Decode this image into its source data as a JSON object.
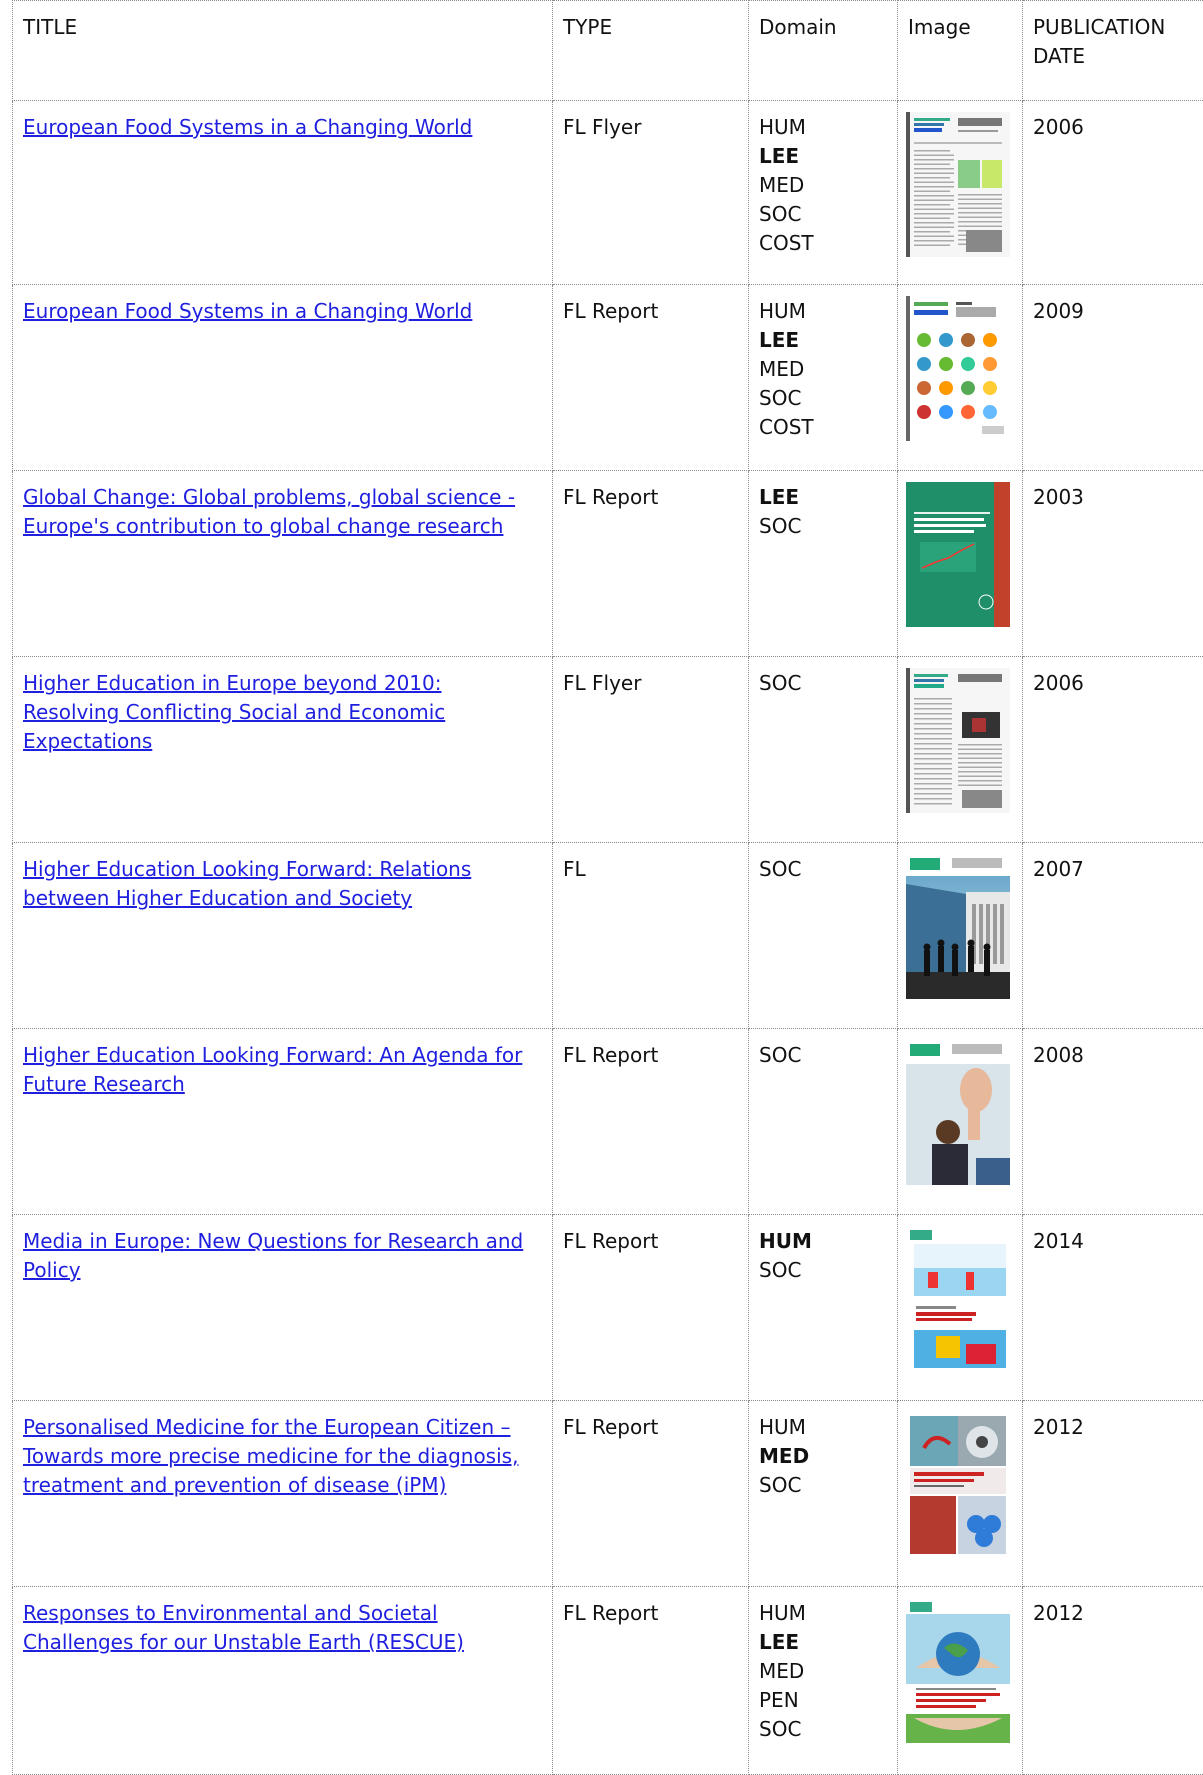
{
  "headers": {
    "title": "TITLE",
    "type": "TYPE",
    "domain": "Domain",
    "image": "Image",
    "date": "PUBLICATION DATE"
  },
  "rows": [
    {
      "title": "European Food Systems in a Changing World",
      "type": "FL Flyer",
      "domains": [
        {
          "code": "HUM",
          "bold": false
        },
        {
          "code": "LEE",
          "bold": true
        },
        {
          "code": "MED",
          "bold": false
        },
        {
          "code": "SOC",
          "bold": false
        },
        {
          "code": "COST",
          "bold": false
        }
      ],
      "image": "flyer-cover-food-systems",
      "date": "2006"
    },
    {
      "title": "European Food Systems in a Changing World",
      "type": "FL Report",
      "domains": [
        {
          "code": "HUM",
          "bold": false
        },
        {
          "code": "LEE",
          "bold": true
        },
        {
          "code": "MED",
          "bold": false
        },
        {
          "code": "SOC",
          "bold": false
        },
        {
          "code": "COST",
          "bold": false
        }
      ],
      "image": "report-cover-food-icons",
      "date": "2009"
    },
    {
      "title": "Global Change: Global problems, global science - Europe's contribution to global change research",
      "type": "FL Report",
      "domains": [
        {
          "code": "LEE",
          "bold": true
        },
        {
          "code": "SOC",
          "bold": false
        }
      ],
      "image": "report-cover-green-global-change",
      "date": "2003"
    },
    {
      "title": "Higher Education in Europe beyond 2010: Resolving Conflicting Social and Economic Expectations",
      "type": "FL Flyer",
      "domains": [
        {
          "code": "SOC",
          "bold": false
        }
      ],
      "image": "flyer-cover-higher-education",
      "date": "2006"
    },
    {
      "title": "Higher Education Looking Forward: Relations between Higher Education and Society",
      "type": "FL",
      "domains": [
        {
          "code": "SOC",
          "bold": false
        }
      ],
      "image": "cover-building-silhouettes",
      "date": "2007"
    },
    {
      "title": "Higher Education Looking Forward: An Agenda for Future Research",
      "type": "FL Report",
      "domains": [
        {
          "code": "SOC",
          "bold": false
        }
      ],
      "image": "cover-student-raised-hand",
      "date": "2008"
    },
    {
      "title": "Media in Europe: New Questions for Research and Policy",
      "type": "FL Report",
      "domains": [
        {
          "code": "HUM",
          "bold": true
        },
        {
          "code": "SOC",
          "bold": false
        }
      ],
      "image": "cover-media-collage",
      "date": "2014"
    },
    {
      "title": "Personalised Medicine for the European Citizen – Towards more precise medicine for the diagnosis, treatment and prevention of disease (iPM)",
      "type": "FL Report",
      "domains": [
        {
          "code": "HUM",
          "bold": false
        },
        {
          "code": "MED",
          "bold": true
        },
        {
          "code": "SOC",
          "bold": false
        }
      ],
      "image": "cover-personalised-medicine",
      "date": "2012"
    },
    {
      "title": "Responses to Environmental and Societal Challenges for our Unstable Earth (RESCUE)",
      "type": "FL Report",
      "domains": [
        {
          "code": "HUM",
          "bold": false
        },
        {
          "code": "LEE",
          "bold": true
        },
        {
          "code": "MED",
          "bold": false
        },
        {
          "code": "PEN",
          "bold": false
        },
        {
          "code": "SOC",
          "bold": false
        }
      ],
      "image": "cover-globe-hands",
      "date": "2012"
    }
  ],
  "colors": {
    "link": "#1f1fe0",
    "border": "#8a8a8a",
    "text": "#111111"
  }
}
